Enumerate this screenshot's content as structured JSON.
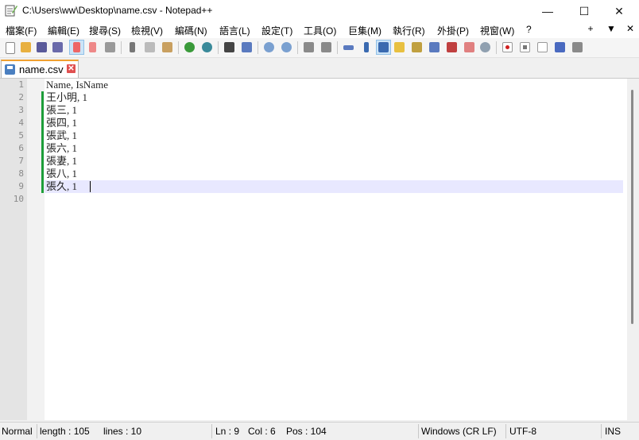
{
  "window": {
    "title": "C:\\Users\\ww\\Desktop\\name.csv - Notepad++",
    "minimize_label": "—",
    "maximize_label": "☐",
    "close_label": "✕"
  },
  "menu": {
    "items": [
      "檔案(F)",
      "編輯(E)",
      "搜尋(S)",
      "檢視(V)",
      "編碼(N)",
      "語言(L)",
      "設定(T)",
      "工具(O)",
      "巨集(M)",
      "執行(R)",
      "外掛(P)",
      "視窗(W)",
      "?"
    ],
    "plus_label": "+",
    "dropdown_label": "▼",
    "close_label": "✕"
  },
  "toolbar": {
    "icons": [
      "new-file-icon",
      "open-file-icon",
      "save-icon",
      "save-all-icon",
      "close-icon",
      "close-all-icon",
      "print-icon",
      "cut-icon",
      "copy-icon",
      "paste-icon",
      "undo-icon",
      "redo-icon",
      "find-icon",
      "replace-icon",
      "zoom-in-icon",
      "zoom-out-icon",
      "sync-vertical-icon",
      "sync-horizontal-icon",
      "word-wrap-icon",
      "show-all-chars-icon",
      "indent-guide-icon",
      "language-icon",
      "doc-map-icon",
      "function-list-icon",
      "folder-workspace-icon",
      "doc-list-icon",
      "monitor-icon",
      "record-macro-icon",
      "stop-macro-icon",
      "play-macro-icon",
      "run-macro-multiple-icon",
      "save-macro-icon"
    ]
  },
  "tab": {
    "label": "name.csv",
    "close_label": "✕"
  },
  "editor": {
    "lines": [
      "Name, IsName",
      "王小明, 1",
      "張三, 1",
      "張四, 1",
      "張武, 1",
      "張六, 1",
      "張妻, 1",
      "張八, 1",
      "張久, 1",
      ""
    ],
    "line_numbers": [
      "1",
      "2",
      "3",
      "4",
      "5",
      "6",
      "7",
      "8",
      "9",
      "10"
    ]
  },
  "status": {
    "type": "Normal",
    "length": "length : 105",
    "lines": "lines : 10",
    "ln": "Ln : 9",
    "col": "Col : 6",
    "pos": "Pos : 104",
    "eol": "Windows (CR LF)",
    "encoding": "UTF-8",
    "mode": "INS"
  },
  "colors": {
    "change_marker": "#1e9e3a",
    "current_line": "#e8e8ff",
    "tab_accent": "#f0a030"
  }
}
